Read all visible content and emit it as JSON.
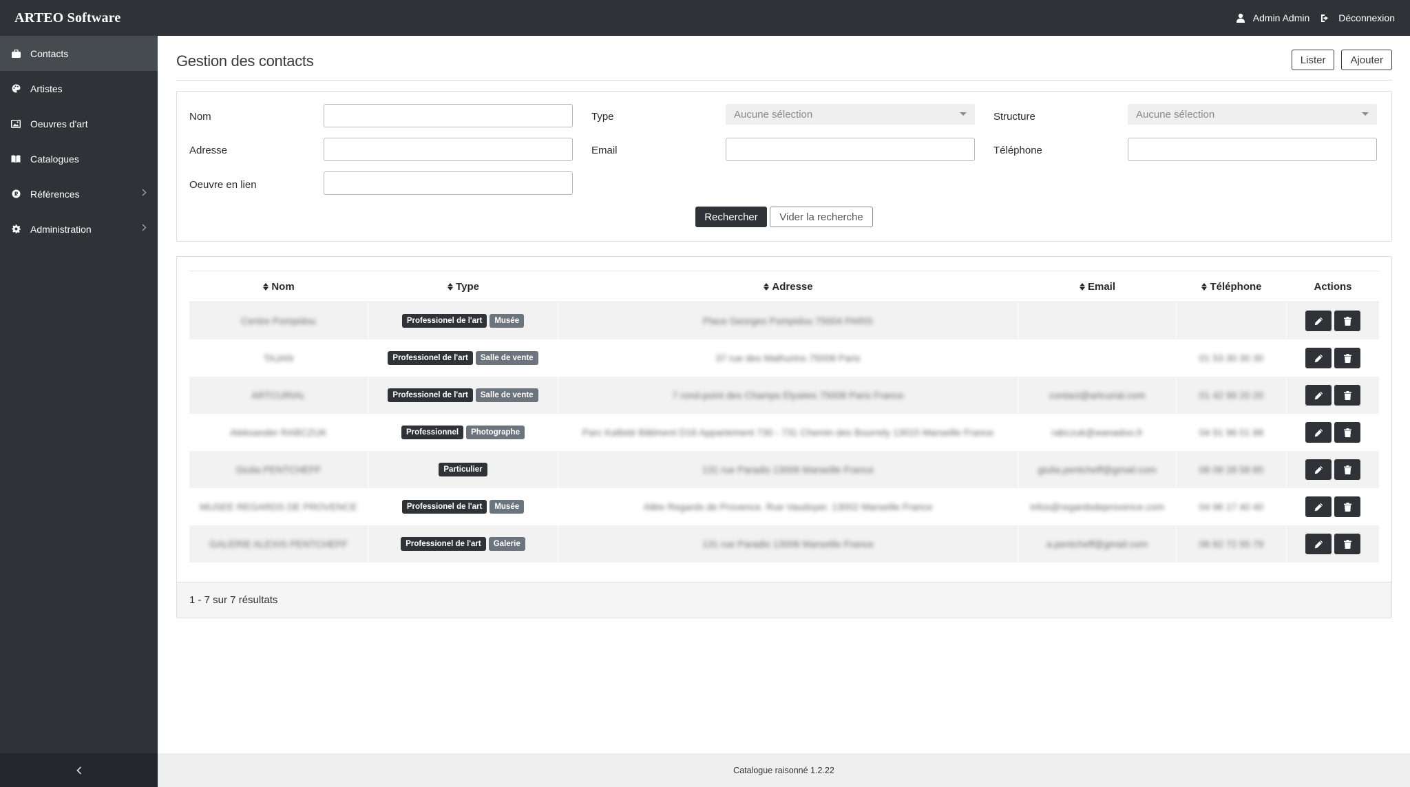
{
  "topbar": {
    "brand": "ARTEO Software",
    "user_name": "Admin Admin",
    "logout_label": "Déconnexion"
  },
  "sidebar": {
    "items": [
      {
        "label": "Contacts",
        "icon": "briefcase-icon",
        "active": true
      },
      {
        "label": "Artistes",
        "icon": "palette-icon"
      },
      {
        "label": "Oeuvres d'art",
        "icon": "image-icon"
      },
      {
        "label": "Catalogues",
        "icon": "book-icon"
      },
      {
        "label": "Références",
        "icon": "registered-icon",
        "has_children": true
      },
      {
        "label": "Administration",
        "icon": "gear-icon",
        "has_children": true
      }
    ]
  },
  "page": {
    "title": "Gestion des contacts",
    "btn_list": "Lister",
    "btn_add": "Ajouter"
  },
  "filters": {
    "nom_label": "Nom",
    "type_label": "Type",
    "type_placeholder": "Aucune sélection",
    "structure_label": "Structure",
    "structure_placeholder": "Aucune sélection",
    "adresse_label": "Adresse",
    "email_label": "Email",
    "telephone_label": "Téléphone",
    "oeuvre_label": "Oeuvre en lien",
    "search_btn": "Rechercher",
    "clear_btn": "Vider la recherche"
  },
  "table": {
    "headers": {
      "nom": "Nom",
      "type": "Type",
      "adresse": "Adresse",
      "email": "Email",
      "telephone": "Téléphone",
      "actions": "Actions"
    },
    "rows": [
      {
        "nom": "Centre Pompidou",
        "badges": [
          "Professionel de l'art",
          "Musée"
        ],
        "adresse": "Place Georges Pompidou 75004 PARIS",
        "email": "",
        "telephone": ""
      },
      {
        "nom": "TAJAN",
        "badges": [
          "Professionel de l'art",
          "Salle de vente"
        ],
        "adresse": "37 rue des Mathurins 75008 Paris",
        "email": "",
        "telephone": "01 53 30 30 30"
      },
      {
        "nom": "ARTCURIAL",
        "badges": [
          "Professionel de l'art",
          "Salle de vente"
        ],
        "adresse": "7 rond-point des Champs Elysées 75008 Paris France",
        "email": "contact@artcurial.com",
        "telephone": "01 42 99 20 20"
      },
      {
        "nom": "Aleksander RABCZUK",
        "badges": [
          "Professionnel",
          "Photographe"
        ],
        "adresse": "Parc Kallisté Bâtiment D16 Appartement 730 - 731 Chemin des Bourrely 13015 Marseille France",
        "email": "rabczuk@wanadoo.fr",
        "telephone": "04 91 96 01 88"
      },
      {
        "nom": "Giulia PENTCHEFF",
        "badges": [
          "Particulier"
        ],
        "adresse": "131 rue Paradis 13006 Marseille France",
        "email": "giulia.pentcheff@gmail.com",
        "telephone": "06 08 28 58 85"
      },
      {
        "nom": "MUSEE REGARDS DE PROVENCE",
        "badges": [
          "Professionel de l'art",
          "Musée"
        ],
        "adresse": "Allée Regards de Provence. Rue Vaudoyer. 13002 Marseille France",
        "email": "infos@regardsdeprovence.com",
        "telephone": "04 96 17 40 40"
      },
      {
        "nom": "GALERIE ALEXIS PENTCHEFF",
        "badges": [
          "Professionel de l'art",
          "Galerie"
        ],
        "adresse": "131 rue Paradis 13006 Marseille France",
        "email": "a.pentcheff@gmail.com",
        "telephone": "06 82 72 95 79"
      }
    ]
  },
  "results_summary": "1 - 7 sur 7 résultats",
  "footer": {
    "version": "Catalogue raisonné 1.2.22"
  },
  "colors": {
    "dark": "#2f3337",
    "active_sidebar": "#464b50",
    "badge_grey": "#6c757d"
  }
}
